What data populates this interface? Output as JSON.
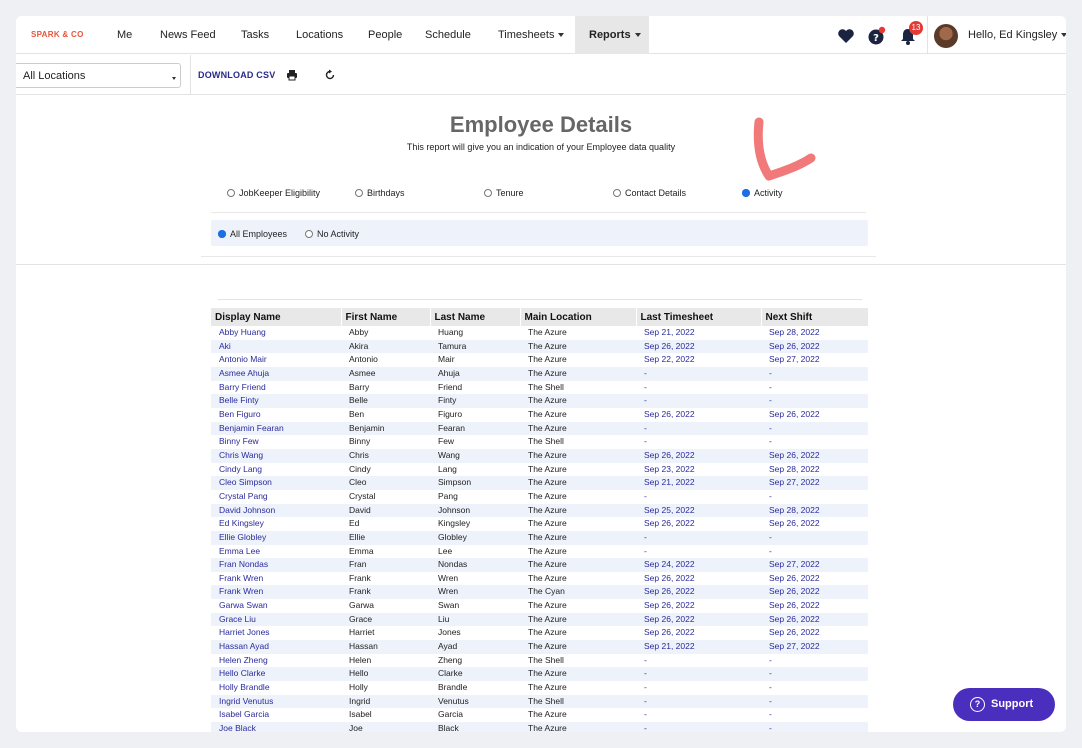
{
  "brand": "SPARK & CO",
  "nav": {
    "items": [
      "Me",
      "News Feed",
      "Tasks",
      "Locations",
      "People",
      "Schedule"
    ],
    "timesheets": "Timesheets",
    "reports": "Reports",
    "notification_count": "13",
    "greeting": "Hello, Ed Kingsley"
  },
  "toolbar": {
    "location": "All Locations",
    "download_csv": "DOWNLOAD CSV"
  },
  "report": {
    "title": "Employee Details",
    "subtitle": "This report will give you an indication of your Employee data quality",
    "options": [
      "JobKeeper Eligibility",
      "Birthdays",
      "Tenure",
      "Contact Details",
      "Activity"
    ],
    "selected_option": "Activity",
    "filters": [
      "All Employees",
      "No Activity"
    ],
    "selected_filter": "All Employees"
  },
  "table": {
    "headers": [
      "Display Name",
      "First Name",
      "Last Name",
      "Main Location",
      "Last Timesheet",
      "Next Shift"
    ],
    "rows": [
      [
        "Abby Huang",
        "Abby",
        "Huang",
        "The Azure",
        "Sep 21, 2022",
        "Sep 28, 2022"
      ],
      [
        "Aki",
        "Akira",
        "Tamura",
        "The Azure",
        "Sep 26, 2022",
        "Sep 26, 2022"
      ],
      [
        "Antonio Mair",
        "Antonio",
        "Mair",
        "The Azure",
        "Sep 22, 2022",
        "Sep 27, 2022"
      ],
      [
        "Asmee Ahuja",
        "Asmee",
        "Ahuja",
        "The Azure",
        "-",
        "-"
      ],
      [
        "Barry Friend",
        "Barry",
        "Friend",
        "The Shell",
        "-",
        "-"
      ],
      [
        "Belle Finty",
        "Belle",
        "Finty",
        "The Azure",
        "-",
        "-"
      ],
      [
        "Ben Figuro",
        "Ben",
        "Figuro",
        "The Azure",
        "Sep 26, 2022",
        "Sep 26, 2022"
      ],
      [
        "Benjamin Fearan",
        "Benjamin",
        "Fearan",
        "The Azure",
        "-",
        "-"
      ],
      [
        "Binny Few",
        "Binny",
        "Few",
        "The Shell",
        "-",
        "-"
      ],
      [
        "Chris Wang",
        "Chris",
        "Wang",
        "The Azure",
        "Sep 26, 2022",
        "Sep 26, 2022"
      ],
      [
        "Cindy Lang",
        "Cindy",
        "Lang",
        "The Azure",
        "Sep 23, 2022",
        "Sep 28, 2022"
      ],
      [
        "Cleo Simpson",
        "Cleo",
        "Simpson",
        "The Azure",
        "Sep 21, 2022",
        "Sep 27, 2022"
      ],
      [
        "Crystal Pang",
        "Crystal",
        "Pang",
        "The Azure",
        "-",
        "-"
      ],
      [
        "David Johnson",
        "David",
        "Johnson",
        "The Azure",
        "Sep 25, 2022",
        "Sep 28, 2022"
      ],
      [
        "Ed Kingsley",
        "Ed",
        "Kingsley",
        "The Azure",
        "Sep 26, 2022",
        "Sep 26, 2022"
      ],
      [
        "Ellie Globley",
        "Ellie",
        "Globley",
        "The Azure",
        "-",
        "-"
      ],
      [
        "Emma Lee",
        "Emma",
        "Lee",
        "The Azure",
        "-",
        "-"
      ],
      [
        "Fran Nondas",
        "Fran",
        "Nondas",
        "The Azure",
        "Sep 24, 2022",
        "Sep 27, 2022"
      ],
      [
        "Frank Wren",
        "Frank",
        "Wren",
        "The Azure",
        "Sep 26, 2022",
        "Sep 26, 2022"
      ],
      [
        "Frank Wren",
        "Frank",
        "Wren",
        "The Cyan",
        "Sep 26, 2022",
        "Sep 26, 2022"
      ],
      [
        "Garwa Swan",
        "Garwa",
        "Swan",
        "The Azure",
        "Sep 26, 2022",
        "Sep 26, 2022"
      ],
      [
        "Grace Liu",
        "Grace",
        "Liu",
        "The Azure",
        "Sep 26, 2022",
        "Sep 26, 2022"
      ],
      [
        "Harriet Jones",
        "Harriet",
        "Jones",
        "The Azure",
        "Sep 26, 2022",
        "Sep 26, 2022"
      ],
      [
        "Hassan Ayad",
        "Hassan",
        "Ayad",
        "The Azure",
        "Sep 21, 2022",
        "Sep 27, 2022"
      ],
      [
        "Helen Zheng",
        "Helen",
        "Zheng",
        "The Shell",
        "-",
        "-"
      ],
      [
        "Hello Clarke",
        "Hello",
        "Clarke",
        "The Azure",
        "-",
        "-"
      ],
      [
        "Holly Brandle",
        "Holly",
        "Brandle",
        "The Azure",
        "-",
        "-"
      ],
      [
        "Ingrid Venutus",
        "Ingrid",
        "Venutus",
        "The Shell",
        "-",
        "-"
      ],
      [
        "Isabel Garcia",
        "Isabel",
        "Garcia",
        "The Azure",
        "-",
        "-"
      ],
      [
        "Joe Black",
        "Joe",
        "Black",
        "The Azure",
        "-",
        "-"
      ]
    ]
  },
  "support": {
    "label": "Support"
  },
  "colors": {
    "brand": "#e8543d",
    "link": "#2a2a9c",
    "support_bg": "#4a2fbf",
    "badge": "#e53935"
  }
}
